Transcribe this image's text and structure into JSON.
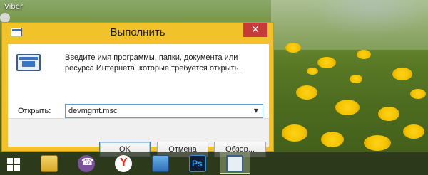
{
  "desktop": {
    "icon_label": "Viber"
  },
  "dialog": {
    "title": "Выполнить",
    "close_glyph": "✕",
    "description": "Введите имя программы, папки, документа или ресурса Интернета, которые требуется открыть.",
    "open_label": "Открыть:",
    "open_value": "devmgmt.msc",
    "dropdown_glyph": "▼",
    "ok_label": "OK",
    "cancel_label": "Отмена",
    "browse_label": "Обзор..."
  },
  "taskbar": {
    "items": [
      {
        "name": "start-button",
        "icon": "windows-logo-icon"
      },
      {
        "name": "file-explorer",
        "icon": "folder-icon"
      },
      {
        "name": "viber",
        "icon": "viber-icon"
      },
      {
        "name": "yandex-browser",
        "icon": "yandex-icon"
      },
      {
        "name": "device-manager",
        "icon": "device-manager-icon"
      },
      {
        "name": "photoshop",
        "icon": "photoshop-icon"
      },
      {
        "name": "run-dialog",
        "icon": "run-icon",
        "active": true
      }
    ]
  },
  "colors": {
    "dialog_frame": "#f2c22b",
    "close_button": "#c73a3a",
    "input_focus_border": "#5aa0d8",
    "ok_border": "#3c7fb1"
  }
}
